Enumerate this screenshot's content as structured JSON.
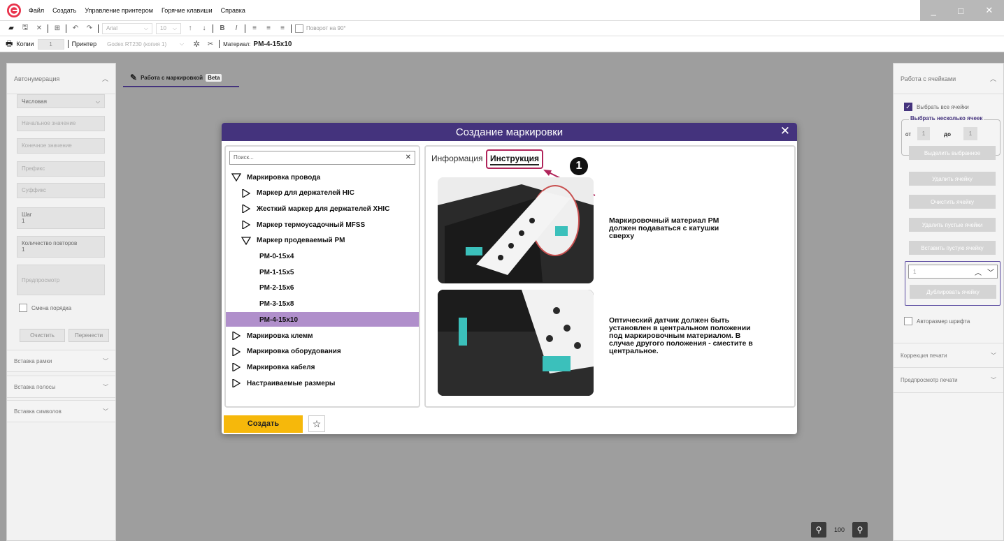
{
  "menu": [
    "Файл",
    "Создать",
    "Управление принтером",
    "Горячие клавиши",
    "Справка"
  ],
  "toolbar1": {
    "font": "Arial",
    "size": "10",
    "rotate_label": "Поворот на 90°"
  },
  "toolbar2": {
    "copies_label": "Копии",
    "copies_value": "1",
    "printer_label": "Принтер",
    "printer_value": "Godex RT230 (копия 1)",
    "material_label": "Материал:",
    "material_value": "PM-4-15x10"
  },
  "left_panel": {
    "title": "Автонумерация",
    "type": "Числовая",
    "start_ph": "Начальное значение",
    "end_ph": "Конечное значение",
    "prefix_ph": "Префикс",
    "suffix_ph": "Суффикс",
    "step_label": "Шаг",
    "step_value": "1",
    "repeat_label": "Количество повторов",
    "repeat_value": "1",
    "preview_ph": "Предпросмотр",
    "order_label": "Смена порядка",
    "clear_btn": "Очистить",
    "move_btn": "Перенести",
    "sections": [
      "Вставка рамки",
      "Вставка полосы",
      "Вставка символов"
    ]
  },
  "center": {
    "tab_label": "Работа с маркировкой",
    "beta": "Beta",
    "zoom": "100"
  },
  "right_panel": {
    "title": "Работа с ячейками",
    "select_all": "Выбрать все ячейки",
    "select_some": "Выбрать несколько ячеек",
    "from": "от",
    "from_value": "1",
    "to": "до",
    "to_value": "1",
    "highlight_btn": "Выделить выбранное",
    "delete_btn": "Удалить ячейку",
    "clear_btn": "Очистить ячейку",
    "delete_empty_btn": "Удалить пустые ячейки",
    "insert_empty_btn": "Вставить пустую ячейку",
    "stepper_value": "1",
    "duplicate_btn": "Дублировать ячейку",
    "autosize": "Авторазмер шрифта",
    "sections": [
      "Коррекция печати",
      "Предпросмотр печати"
    ]
  },
  "dialog": {
    "title": "Создание маркировки",
    "search_ph": "Поиск...",
    "tree": [
      {
        "label": "Маркировка провода",
        "level": 0,
        "open": true
      },
      {
        "label": "Маркер для держателей HIC",
        "level": 1,
        "open": false
      },
      {
        "label": "Жесткий маркер для держателей XHIC",
        "level": 1,
        "open": false
      },
      {
        "label": "Маркер термоусадочный MFSS",
        "level": 1,
        "open": false
      },
      {
        "label": "Маркер продеваемый PM",
        "level": 1,
        "open": true
      },
      {
        "label": "PM-0-15x4",
        "level": 2
      },
      {
        "label": "PM-1-15x5",
        "level": 2
      },
      {
        "label": "PM-2-15x6",
        "level": 2
      },
      {
        "label": "PM-3-15x8",
        "level": 2
      },
      {
        "label": "PM-4-15x10",
        "level": 2,
        "selected": true
      },
      {
        "label": "Маркировка клемм",
        "level": 0,
        "open": false
      },
      {
        "label": "Маркировка оборудования",
        "level": 0,
        "open": false
      },
      {
        "label": "Маркировка кабеля",
        "level": 0,
        "open": false
      },
      {
        "label": "Настраиваемые размеры",
        "level": 0,
        "open": false
      }
    ],
    "tab_info": "Информация",
    "tab_instr": "Инструкция",
    "callout_number": "1",
    "desc1": "Маркировочный материал PM должен подаваться с катушки сверху",
    "desc2": "Оптический датчик должен быть установлен в центральном положении под маркировочным материалом. В случае другого положения - сместите в центральное.",
    "create_btn": "Создать"
  },
  "colors": {
    "accent": "#44337d",
    "selected": "#b08fcb",
    "create": "#f6b80b",
    "callout": "#b0245a"
  }
}
